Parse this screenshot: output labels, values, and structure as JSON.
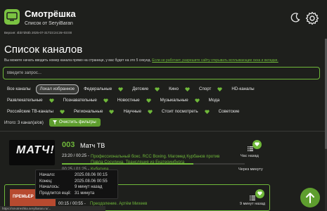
{
  "header": {
    "title": "Смотрёшка",
    "subtitle": "Список от SeryiBaran",
    "version": "Версия: 4bb7d93b 2025-07-31T23:24:26+03:00"
  },
  "page": {
    "title": "Список каналов",
    "hint_text": "Вы можете начать вводить номер канала прямо на странице, у вас будет на это 5 секунд.",
    "hint_link": "Если не работает, разрешите сайту открывать всплывающие окна и вкладки.",
    "search_placeholder": "Введите запрос..."
  },
  "filters": {
    "row1": [
      "Все каналы",
      "Локал избранное",
      "Федеральные",
      "Детские",
      "Кино",
      "Спорт",
      "HD-каналы"
    ],
    "row2": [
      "Развлекательные",
      "Познавательные",
      "Новостные",
      "Музыкальные",
      "Мода"
    ],
    "row3": [
      "Российские ТВ-каналы",
      "Региональные",
      "Научные",
      "Стоит посмотреть",
      "Советские"
    ],
    "active": "Локал избранное"
  },
  "result": {
    "count_text": "Итого: 3 канал(а/ов)",
    "clear_label": "Очистить фильтры"
  },
  "channels": [
    {
      "logo_text": "МАТЧ!",
      "number": "003",
      "name": "Матч ТВ",
      "current_time": "23:20 / 00:25 -",
      "current_title": "Профессиональный бокс. RCC Boxing. Магомед Курбанов против Павла Сосулина. Трансляция из Екатеринбурга",
      "current_ago": "Час назад",
      "progress": 0.72,
      "next_time": "00:25 / 01:25 -",
      "next_title": "Кубатура",
      "next_ago": "Через минуту"
    },
    {
      "logo_text": "ПРЕМЬЕР",
      "current_time": "00:15 / 00:55 -",
      "current_title": "Преодоление. Артём Михеев",
      "current_ago": "9 минут назад"
    }
  ],
  "tooltip": {
    "rows": [
      {
        "key": "Начало:",
        "value": "2025.08.06 00:15"
      },
      {
        "key": "Конец:",
        "value": "2025.08.06 00:55"
      },
      {
        "key": "Началось:",
        "value": "9 минут назад"
      },
      {
        "key": "Продлится ещё:",
        "value": "31 минута"
      }
    ]
  },
  "status_url": "https://smotreshka.seryibaran.ru/...",
  "colors": {
    "accent": "#6fb83a",
    "background": "#1e1f1c"
  }
}
